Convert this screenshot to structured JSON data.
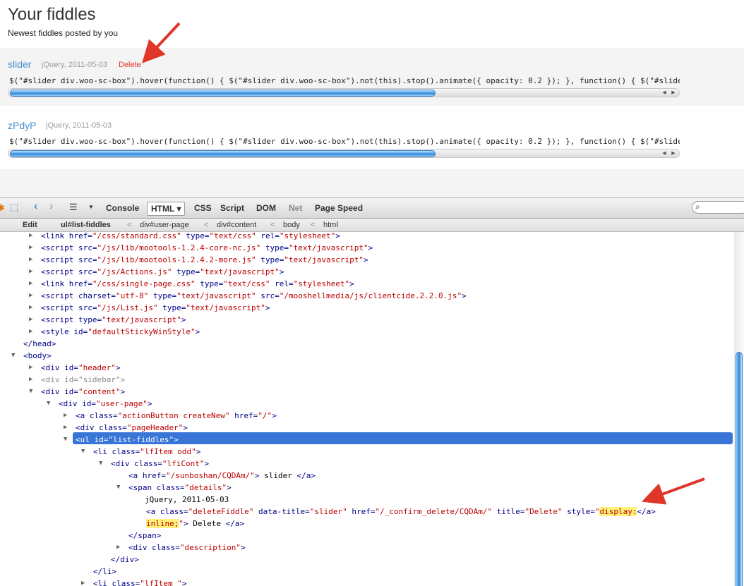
{
  "page": {
    "title": "Your fiddles",
    "subtitle": "Newest fiddles posted by you"
  },
  "fiddles": [
    {
      "name": "slider",
      "meta": "jQuery, 2011-05-03",
      "delete": "Delete",
      "code": "$(\"#slider div.woo-sc-box\").hover(function() { $(\"#slider div.woo-sc-box\").not(this).stop().animate({ opacity: 0.2 }); }, function() { $(\"#slider d"
    },
    {
      "name": "zPdyP",
      "meta": "jQuery, 2011-05-03",
      "code": "$(\"#slider div.woo-sc-box\").hover(function() { $(\"#slider div.woo-sc-box\").not(this).stop().animate({ opacity: 0.2 }); }, function() { $(\"#slider d"
    }
  ],
  "firebug": {
    "tabs": [
      "Console",
      "HTML ▾",
      "CSS",
      "Script",
      "DOM",
      "Net",
      "Page Speed"
    ],
    "breadcrumbs": [
      "Edit",
      "ul#list-fiddles",
      "<",
      "div#user-page",
      "<",
      "div#content",
      "<",
      "body",
      "<",
      "html"
    ]
  },
  "tree": {
    "l0": {
      "tag": "link",
      "attrs": [
        [
          "href",
          "/css/standard.css"
        ],
        [
          "type",
          "text/css"
        ],
        [
          "rel",
          "stylesheet"
        ]
      ]
    },
    "l1": {
      "tag": "script",
      "attrs": [
        [
          "src",
          "/js/lib/mootools-1.2.4-core-nc.js"
        ],
        [
          "type",
          "text/javascript"
        ]
      ]
    },
    "l2": {
      "tag": "script",
      "attrs": [
        [
          "src",
          "/js/lib/mootools-1.2.4.2-more.js"
        ],
        [
          "type",
          "text/javascript"
        ]
      ]
    },
    "l3": {
      "tag": "script",
      "attrs": [
        [
          "src",
          "/js/Actions.js"
        ],
        [
          "type",
          "text/javascript"
        ]
      ]
    },
    "l4": {
      "tag": "link",
      "attrs": [
        [
          "href",
          "/css/single-page.css"
        ],
        [
          "type",
          "text/css"
        ],
        [
          "rel",
          "stylesheet"
        ]
      ]
    },
    "l5": {
      "tag": "script",
      "attrs": [
        [
          "charset",
          "utf-8"
        ],
        [
          "type",
          "text/javascript"
        ],
        [
          "src",
          "/mooshellmedia/js/clientcide.2.2.0.js"
        ]
      ]
    },
    "l6": {
      "tag": "script",
      "attrs": [
        [
          "src",
          "/js/List.js"
        ],
        [
          "type",
          "text/javascript"
        ]
      ]
    },
    "l7": {
      "tag": "script",
      "attrs": [
        [
          "type",
          "text/javascript"
        ]
      ]
    },
    "l8": {
      "tag": "style",
      "attrs": [
        [
          "id",
          "defaultStickyWinStyle"
        ]
      ]
    },
    "l9": {
      "close": "head"
    },
    "l10": {
      "tag": "body",
      "attrs": []
    },
    "l11": {
      "tag": "div",
      "attrs": [
        [
          "id",
          "header"
        ]
      ]
    },
    "l12": {
      "tag": "div",
      "attrs": [
        [
          "id",
          "sidebar"
        ]
      ],
      "grey": true
    },
    "l13": {
      "tag": "div",
      "attrs": [
        [
          "id",
          "content"
        ]
      ]
    },
    "l14": {
      "tag": "div",
      "attrs": [
        [
          "id",
          "user-page"
        ]
      ]
    },
    "l15": {
      "tag": "a",
      "attrs": [
        [
          "class",
          "actionButton createNew"
        ],
        [
          "href",
          "/"
        ]
      ]
    },
    "l16": {
      "tag": "div",
      "attrs": [
        [
          "class",
          "pageHeader"
        ]
      ]
    },
    "l17": {
      "tag": "ul",
      "attrs": [
        [
          "id",
          "list-fiddles"
        ]
      ],
      "selected": true
    },
    "l18": {
      "tag": "li",
      "attrs": [
        [
          "class",
          "lfItem odd"
        ]
      ]
    },
    "l19": {
      "tag": "div",
      "attrs": [
        [
          "class",
          "lfiCont"
        ]
      ]
    },
    "l20": {
      "tag": "a",
      "attrs": [
        [
          "href",
          "/sunboshan/CQDAm/"
        ]
      ],
      "text": " slider ",
      "close": "a"
    },
    "l21": {
      "tag": "span",
      "attrs": [
        [
          "class",
          "details"
        ]
      ]
    },
    "l22": {
      "text": "jQuery, 2011-05-03"
    },
    "l23": {
      "tag": "a",
      "attrs": [
        [
          "class",
          "deleteFiddle"
        ],
        [
          "data-title",
          "slider"
        ],
        [
          "href",
          "/_confirm_delete/CQDAm/"
        ],
        [
          "title",
          "Delete"
        ]
      ],
      "style_name": "style",
      "style_val_a": "display:",
      "style_val_b": "inline;",
      "text": " Delete ",
      "close": "a"
    },
    "l24": {
      "close": "span"
    },
    "l25": {
      "tag": "div",
      "attrs": [
        [
          "class",
          "description"
        ]
      ]
    },
    "l26": {
      "close": "div"
    },
    "l27": {
      "close": "li"
    },
    "l28": {
      "tag": "li",
      "attrs": [
        [
          "class",
          "lfItem "
        ]
      ]
    }
  }
}
